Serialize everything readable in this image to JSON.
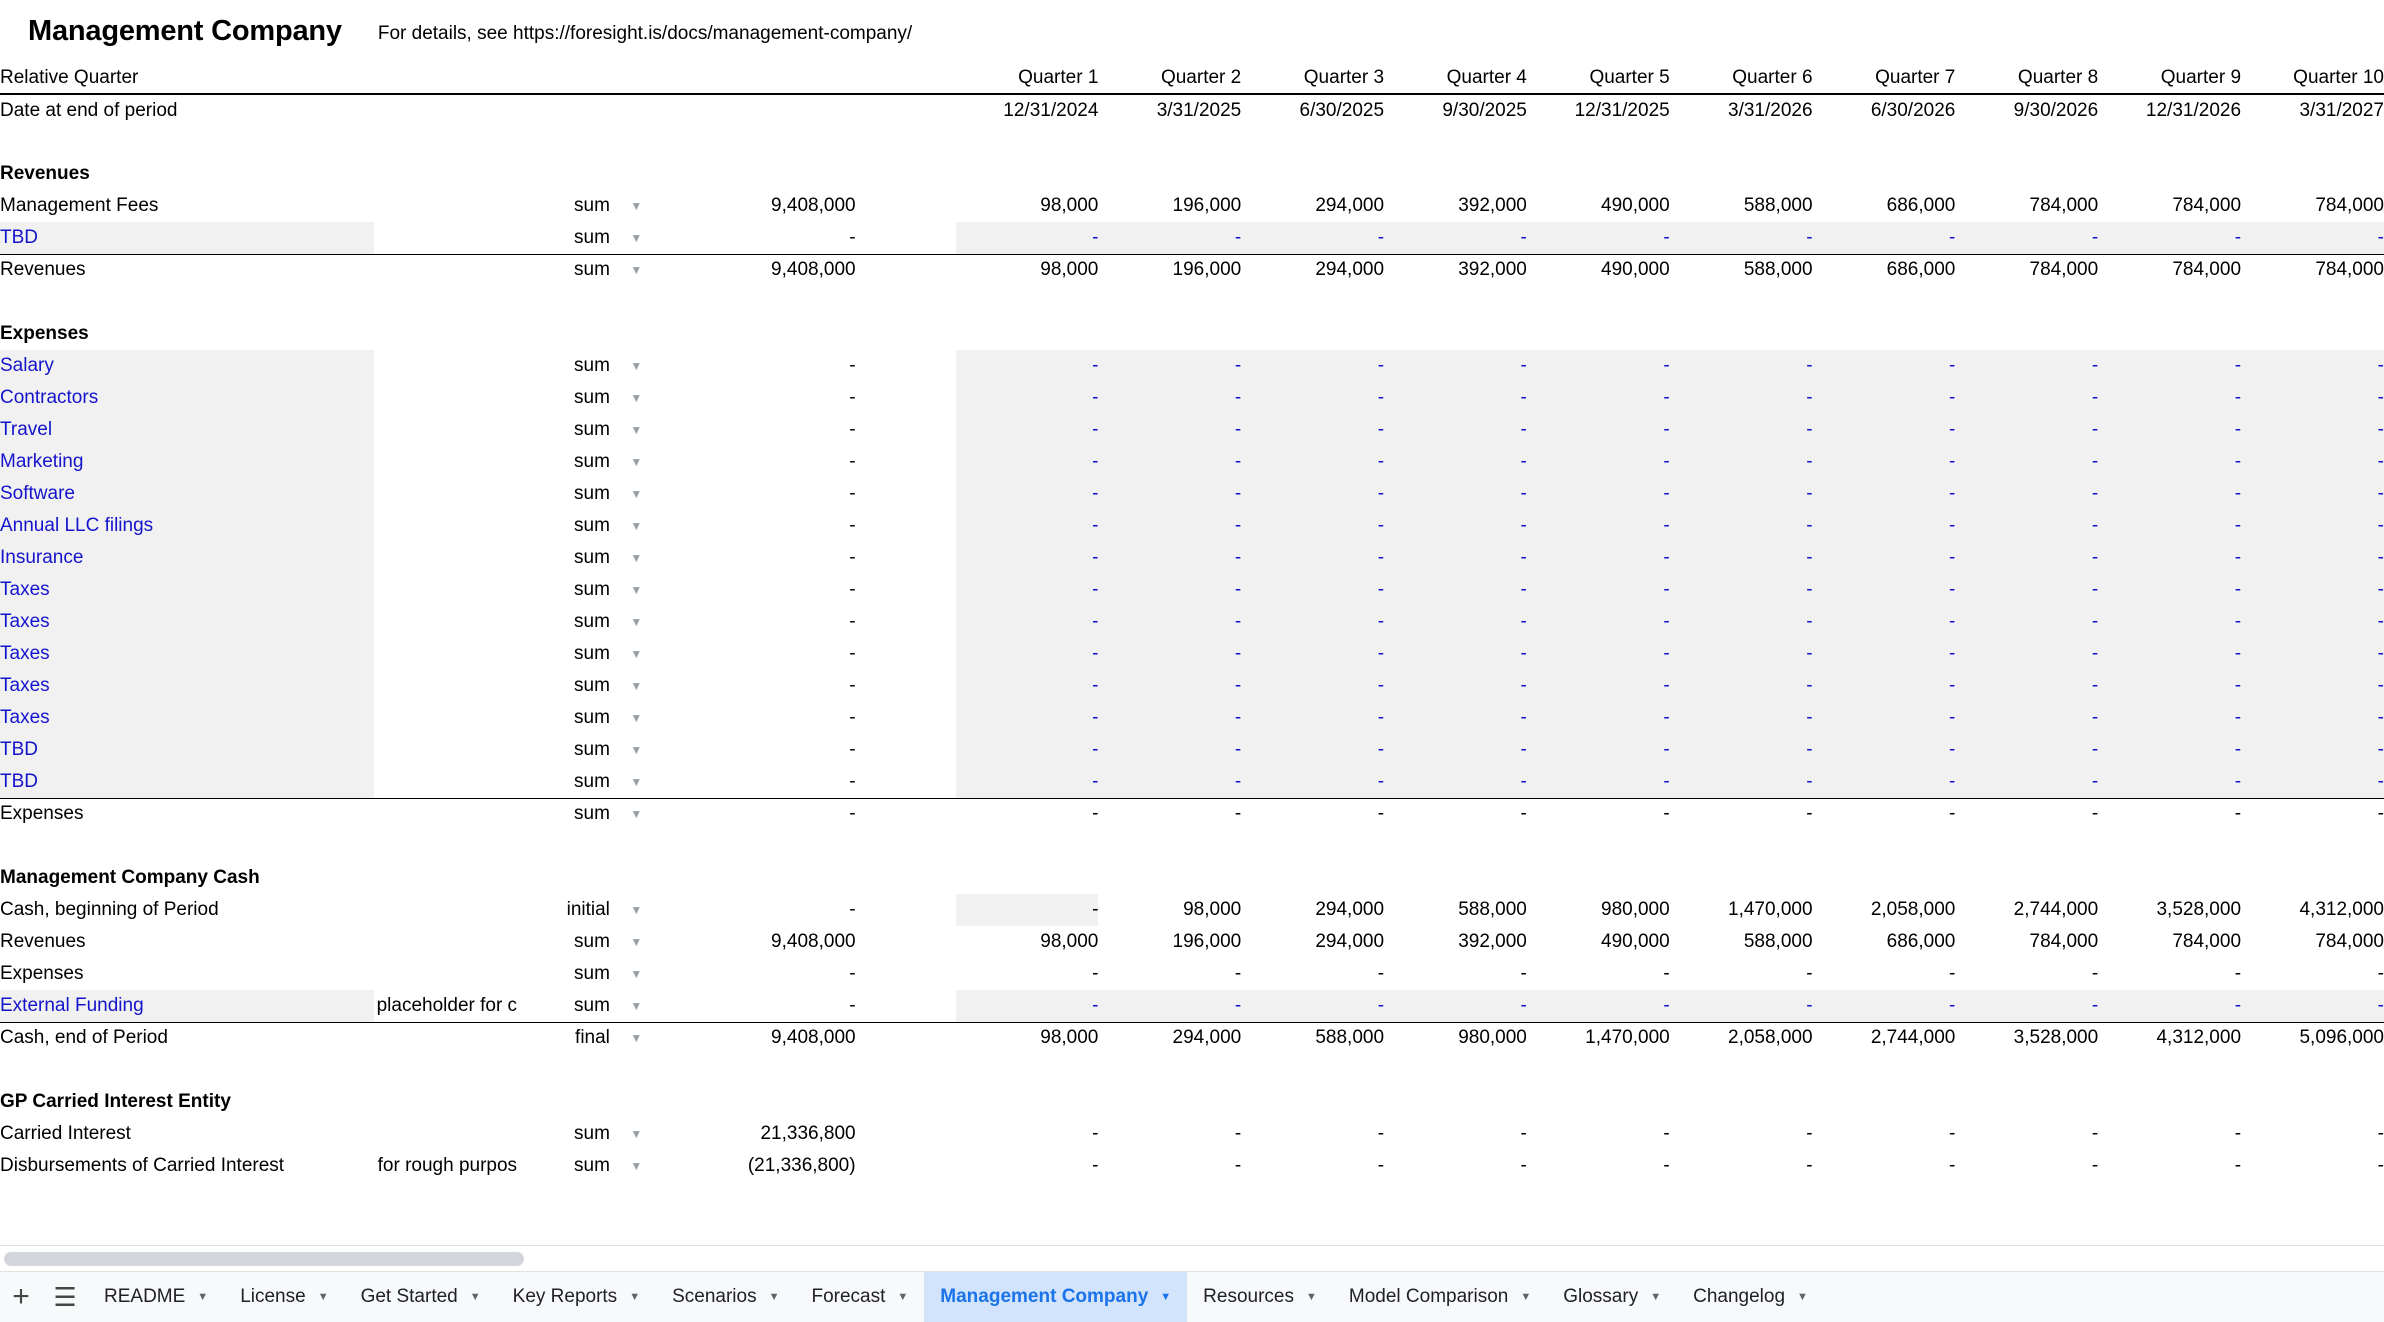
{
  "header": {
    "title": "Management Company",
    "subtitle": "For details, see https://foresight.is/docs/management-company/"
  },
  "table": {
    "row_header_label": "Relative Quarter",
    "date_row_label": "Date at end of period",
    "quarters": [
      "Quarter 1",
      "Quarter 2",
      "Quarter 3",
      "Quarter 4",
      "Quarter 5",
      "Quarter 6",
      "Quarter 7",
      "Quarter 8",
      "Quarter 9",
      "Quarter 10"
    ],
    "dates": [
      "12/31/2024",
      "3/31/2025",
      "6/30/2025",
      "9/30/2025",
      "12/31/2025",
      "3/31/2026",
      "6/30/2026",
      "9/30/2026",
      "12/31/2026",
      "3/31/2027"
    ],
    "sections": [
      {
        "name": "Revenues",
        "rows": [
          {
            "label": "Management Fees",
            "note": "",
            "agg": "sum",
            "total": "9,408,000",
            "input": false,
            "values": [
              "98,000",
              "196,000",
              "294,000",
              "392,000",
              "490,000",
              "588,000",
              "686,000",
              "784,000",
              "784,000",
              "784,000"
            ]
          },
          {
            "label": "TBD",
            "note": "",
            "agg": "sum",
            "total": "-",
            "input": true,
            "values": [
              "-",
              "-",
              "-",
              "-",
              "-",
              "-",
              "-",
              "-",
              "-",
              "-"
            ]
          },
          {
            "label": "Revenues",
            "note": "",
            "agg": "sum",
            "total": "9,408,000",
            "input": false,
            "subtotal": true,
            "values": [
              "98,000",
              "196,000",
              "294,000",
              "392,000",
              "490,000",
              "588,000",
              "686,000",
              "784,000",
              "784,000",
              "784,000"
            ]
          }
        ]
      },
      {
        "name": "Expenses",
        "rows": [
          {
            "label": "Salary",
            "note": "",
            "agg": "sum",
            "total": "-",
            "input": true,
            "values": [
              "-",
              "-",
              "-",
              "-",
              "-",
              "-",
              "-",
              "-",
              "-",
              "-"
            ]
          },
          {
            "label": "Contractors",
            "note": "",
            "agg": "sum",
            "total": "-",
            "input": true,
            "values": [
              "-",
              "-",
              "-",
              "-",
              "-",
              "-",
              "-",
              "-",
              "-",
              "-"
            ]
          },
          {
            "label": "Travel",
            "note": "",
            "agg": "sum",
            "total": "-",
            "input": true,
            "values": [
              "-",
              "-",
              "-",
              "-",
              "-",
              "-",
              "-",
              "-",
              "-",
              "-"
            ]
          },
          {
            "label": "Marketing",
            "note": "",
            "agg": "sum",
            "total": "-",
            "input": true,
            "values": [
              "-",
              "-",
              "-",
              "-",
              "-",
              "-",
              "-",
              "-",
              "-",
              "-"
            ]
          },
          {
            "label": "Software",
            "note": "",
            "agg": "sum",
            "total": "-",
            "input": true,
            "values": [
              "-",
              "-",
              "-",
              "-",
              "-",
              "-",
              "-",
              "-",
              "-",
              "-"
            ]
          },
          {
            "label": "Annual LLC filings",
            "note": "",
            "agg": "sum",
            "total": "-",
            "input": true,
            "values": [
              "-",
              "-",
              "-",
              "-",
              "-",
              "-",
              "-",
              "-",
              "-",
              "-"
            ]
          },
          {
            "label": "Insurance",
            "note": "",
            "agg": "sum",
            "total": "-",
            "input": true,
            "values": [
              "-",
              "-",
              "-",
              "-",
              "-",
              "-",
              "-",
              "-",
              "-",
              "-"
            ]
          },
          {
            "label": "Taxes",
            "note": "",
            "agg": "sum",
            "total": "-",
            "input": true,
            "values": [
              "-",
              "-",
              "-",
              "-",
              "-",
              "-",
              "-",
              "-",
              "-",
              "-"
            ]
          },
          {
            "label": "Taxes",
            "note": "",
            "agg": "sum",
            "total": "-",
            "input": true,
            "values": [
              "-",
              "-",
              "-",
              "-",
              "-",
              "-",
              "-",
              "-",
              "-",
              "-"
            ]
          },
          {
            "label": "Taxes",
            "note": "",
            "agg": "sum",
            "total": "-",
            "input": true,
            "values": [
              "-",
              "-",
              "-",
              "-",
              "-",
              "-",
              "-",
              "-",
              "-",
              "-"
            ]
          },
          {
            "label": "Taxes",
            "note": "",
            "agg": "sum",
            "total": "-",
            "input": true,
            "values": [
              "-",
              "-",
              "-",
              "-",
              "-",
              "-",
              "-",
              "-",
              "-",
              "-"
            ]
          },
          {
            "label": "Taxes",
            "note": "",
            "agg": "sum",
            "total": "-",
            "input": true,
            "values": [
              "-",
              "-",
              "-",
              "-",
              "-",
              "-",
              "-",
              "-",
              "-",
              "-"
            ]
          },
          {
            "label": "TBD",
            "note": "",
            "agg": "sum",
            "total": "-",
            "input": true,
            "values": [
              "-",
              "-",
              "-",
              "-",
              "-",
              "-",
              "-",
              "-",
              "-",
              "-"
            ]
          },
          {
            "label": "TBD",
            "note": "",
            "agg": "sum",
            "total": "-",
            "input": true,
            "values": [
              "-",
              "-",
              "-",
              "-",
              "-",
              "-",
              "-",
              "-",
              "-",
              "-"
            ]
          },
          {
            "label": "Expenses",
            "note": "",
            "agg": "sum",
            "total": "-",
            "input": false,
            "subtotal": true,
            "values": [
              "-",
              "-",
              "-",
              "-",
              "-",
              "-",
              "-",
              "-",
              "-",
              "-"
            ]
          }
        ]
      },
      {
        "name": "Management Company Cash",
        "rows": [
          {
            "label": "Cash, beginning of Period",
            "note": "",
            "agg": "initial",
            "total": "-",
            "input": false,
            "first_shaded": true,
            "values": [
              "-",
              "98,000",
              "294,000",
              "588,000",
              "980,000",
              "1,470,000",
              "2,058,000",
              "2,744,000",
              "3,528,000",
              "4,312,000"
            ]
          },
          {
            "label": "Revenues",
            "note": "",
            "agg": "sum",
            "total": "9,408,000",
            "input": false,
            "values": [
              "98,000",
              "196,000",
              "294,000",
              "392,000",
              "490,000",
              "588,000",
              "686,000",
              "784,000",
              "784,000",
              "784,000"
            ]
          },
          {
            "label": "Expenses",
            "note": "",
            "agg": "sum",
            "total": "-",
            "input": false,
            "values": [
              "-",
              "-",
              "-",
              "-",
              "-",
              "-",
              "-",
              "-",
              "-",
              "-"
            ]
          },
          {
            "label": "External Funding",
            "note": "placeholder for c",
            "agg": "sum",
            "total": "-",
            "input": true,
            "values": [
              "-",
              "-",
              "-",
              "-",
              "-",
              "-",
              "-",
              "-",
              "-",
              "-"
            ]
          },
          {
            "label": "Cash, end of Period",
            "note": "",
            "agg": "final",
            "total": "9,408,000",
            "input": false,
            "subtotal": true,
            "values": [
              "98,000",
              "294,000",
              "588,000",
              "980,000",
              "1,470,000",
              "2,058,000",
              "2,744,000",
              "3,528,000",
              "4,312,000",
              "5,096,000"
            ]
          }
        ]
      },
      {
        "name": "GP Carried Interest Entity",
        "rows": [
          {
            "label": "Carried Interest",
            "note": "",
            "agg": "sum",
            "total": "21,336,800",
            "input": false,
            "values": [
              "-",
              "-",
              "-",
              "-",
              "-",
              "-",
              "-",
              "-",
              "-",
              "-"
            ]
          },
          {
            "label": "Disbursements of Carried Interest",
            "note": "for rough purpos",
            "agg": "sum",
            "total": "(21,336,800)",
            "input": false,
            "values": [
              "-",
              "-",
              "-",
              "-",
              "-",
              "-",
              "-",
              "-",
              "-",
              "-"
            ]
          }
        ]
      }
    ]
  },
  "bottom_bar": {
    "add_sheet_icon": "plus-icon",
    "all_sheets_icon": "hamburger-icon",
    "tabs": [
      {
        "label": "README",
        "active": false
      },
      {
        "label": "License",
        "active": false
      },
      {
        "label": "Get Started",
        "active": false
      },
      {
        "label": "Key Reports",
        "active": false
      },
      {
        "label": "Scenarios",
        "active": false
      },
      {
        "label": "Forecast",
        "active": false
      },
      {
        "label": "Management Company",
        "active": true
      },
      {
        "label": "Resources",
        "active": false
      },
      {
        "label": "Model Comparison",
        "active": false
      },
      {
        "label": "Glossary",
        "active": false
      },
      {
        "label": "Changelog",
        "active": false
      }
    ]
  },
  "colors": {
    "input_blue": "#1414cc",
    "shade_gray": "#f1f1f1",
    "active_tab_bg": "#d2e3fc",
    "active_tab_text": "#1a73e8"
  }
}
